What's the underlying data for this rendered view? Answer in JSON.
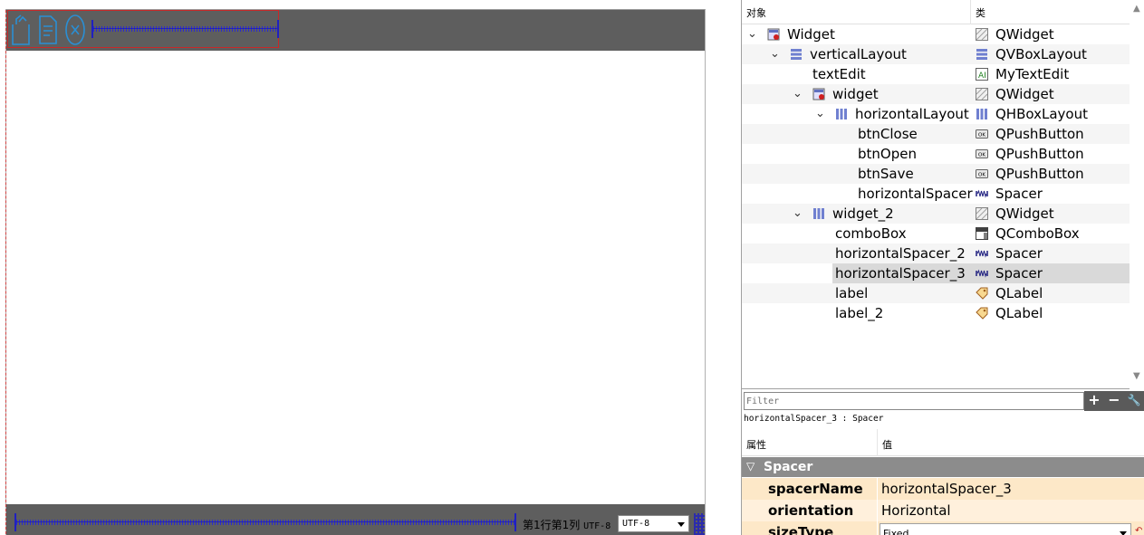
{
  "form": {
    "status_text": "第1行第1列",
    "encoding_label": "UTF-8",
    "encoding_combo_value": "UTF-8"
  },
  "object_inspector": {
    "col_object": "对象",
    "col_class": "类",
    "rows": [
      {
        "name": "Widget",
        "class": "QWidget",
        "expander": "⌄",
        "icon": "widget-icon",
        "class_icon": "qwidget-icon"
      },
      {
        "name": "verticalLayout",
        "class": "QVBoxLayout",
        "expander": "⌄",
        "icon": "vbox-layout-icon",
        "class_icon": "vbox-layout-icon"
      },
      {
        "name": "textEdit",
        "class": "MyTextEdit",
        "expander": "",
        "icon": "",
        "class_icon": "text-edit-icon"
      },
      {
        "name": "widget",
        "class": "QWidget",
        "expander": "⌄",
        "icon": "widget-icon",
        "class_icon": "qwidget-icon"
      },
      {
        "name": "horizontalLayout",
        "class": "QHBoxLayout",
        "expander": "⌄",
        "icon": "hbox-layout-icon",
        "class_icon": "hbox-layout-icon"
      },
      {
        "name": "btnClose",
        "class": "QPushButton",
        "expander": "",
        "icon": "",
        "class_icon": "push-button-icon"
      },
      {
        "name": "btnOpen",
        "class": "QPushButton",
        "expander": "",
        "icon": "",
        "class_icon": "push-button-icon"
      },
      {
        "name": "btnSave",
        "class": "QPushButton",
        "expander": "",
        "icon": "",
        "class_icon": "push-button-icon"
      },
      {
        "name": "horizontalSpacer",
        "class": "Spacer",
        "expander": "",
        "icon": "",
        "class_icon": "spacer-icon"
      },
      {
        "name": "widget_2",
        "class": "QWidget",
        "expander": "⌄",
        "icon": "hbox-layout-icon",
        "class_icon": "qwidget-icon"
      },
      {
        "name": "comboBox",
        "class": "QComboBox",
        "expander": "",
        "icon": "",
        "class_icon": "combo-box-icon"
      },
      {
        "name": "horizontalSpacer_2",
        "class": "Spacer",
        "expander": "",
        "icon": "",
        "class_icon": "spacer-icon"
      },
      {
        "name": "horizontalSpacer_3",
        "class": "Spacer",
        "expander": "",
        "icon": "",
        "class_icon": "spacer-icon",
        "selected": true
      },
      {
        "name": "label",
        "class": "QLabel",
        "expander": "",
        "icon": "",
        "class_icon": "label-icon"
      },
      {
        "name": "label_2",
        "class": "QLabel",
        "expander": "",
        "icon": "",
        "class_icon": "label-icon"
      }
    ]
  },
  "property_editor": {
    "filter_placeholder": "Filter",
    "add_label": "+",
    "remove_label": "−",
    "configure_label": "🔧",
    "selection_label": "horizontalSpacer_3 : Spacer",
    "col_property": "属性",
    "col_value": "值",
    "group_label": "Spacer",
    "properties": [
      {
        "name": "spacerName",
        "value": "horizontalSpacer_3"
      },
      {
        "name": "orientation",
        "value": "Horizontal"
      },
      {
        "name": "sizeType",
        "value": "Fixed"
      }
    ]
  },
  "colors": {
    "toolbar_bg": "#5e5e5e",
    "icon_color": "#2a8fd4",
    "spacer_color": "#2020c0",
    "selection_row": "#d9d9d9",
    "property_row": "#fde8c8",
    "group_header": "#8c8c8c"
  }
}
